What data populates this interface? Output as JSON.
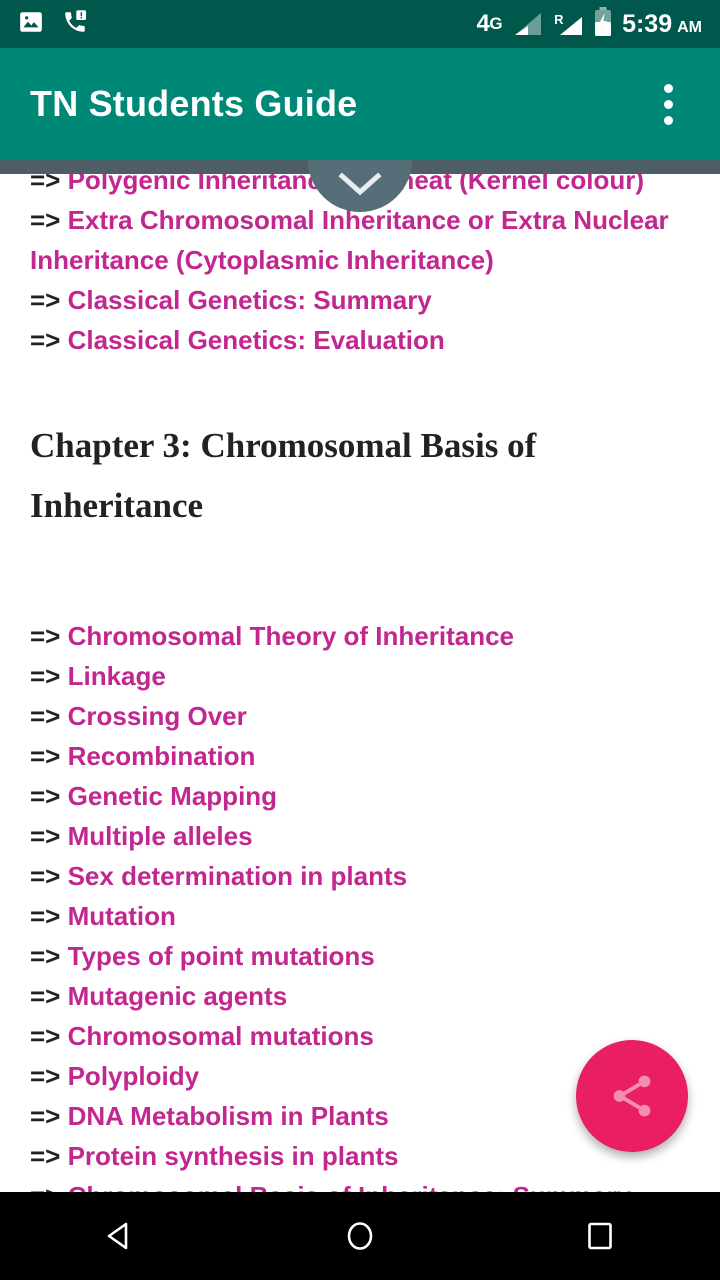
{
  "status_bar": {
    "background": "#00574B",
    "left_icons": [
      {
        "name": "photo-icon",
        "label": "Screenshot captured"
      },
      {
        "name": "missed-call-icon",
        "label": "Missed call"
      }
    ],
    "network_type": "4G",
    "network_type_sup": "G",
    "network_type_main": "4",
    "roaming_letter": "R",
    "battery": "charging",
    "time": "5:39",
    "am_pm": "AM"
  },
  "toolbar": {
    "title": "TN Students Guide",
    "background": "#008877",
    "overflow_label": "More options"
  },
  "content": {
    "accent_link_color": "#C2268F",
    "arrow_marker": "=>",
    "scroll_down_label": "Scroll down",
    "previous_chapter_links": [
      "Polygenic Inheritance in Wheat (Kernel colour)",
      "Extra Chromosomal Inheritance or Extra Nuclear Inheritance (Cytoplasmic Inheritance)",
      "Classical Genetics: Summary",
      "Classical Genetics: Evaluation"
    ],
    "chapter_heading": "Chapter 3: Chromosomal Basis of Inheritance",
    "chapter_links": [
      "Chromosomal Theory of Inheritance",
      "Linkage",
      "Crossing Over",
      "Recombination",
      "Genetic Mapping",
      "Multiple alleles",
      "Sex determination in plants",
      "Mutation",
      "Types of point mutations",
      "Mutagenic agents",
      "Chromosomal mutations",
      "Polyploidy",
      "DNA Metabolism in Plants",
      "Protein synthesis in plants",
      "Chromosomal Basis of Inheritance: Summary"
    ]
  },
  "fab": {
    "name": "share-fab",
    "label": "Share",
    "background": "#E91E63",
    "icon_color": "#F48FB1"
  },
  "nav_bar": {
    "background": "#000000",
    "buttons": [
      {
        "name": "nav-back-button",
        "label": "Back"
      },
      {
        "name": "nav-home-button",
        "label": "Home"
      },
      {
        "name": "nav-recents-button",
        "label": "Recent apps"
      }
    ]
  }
}
